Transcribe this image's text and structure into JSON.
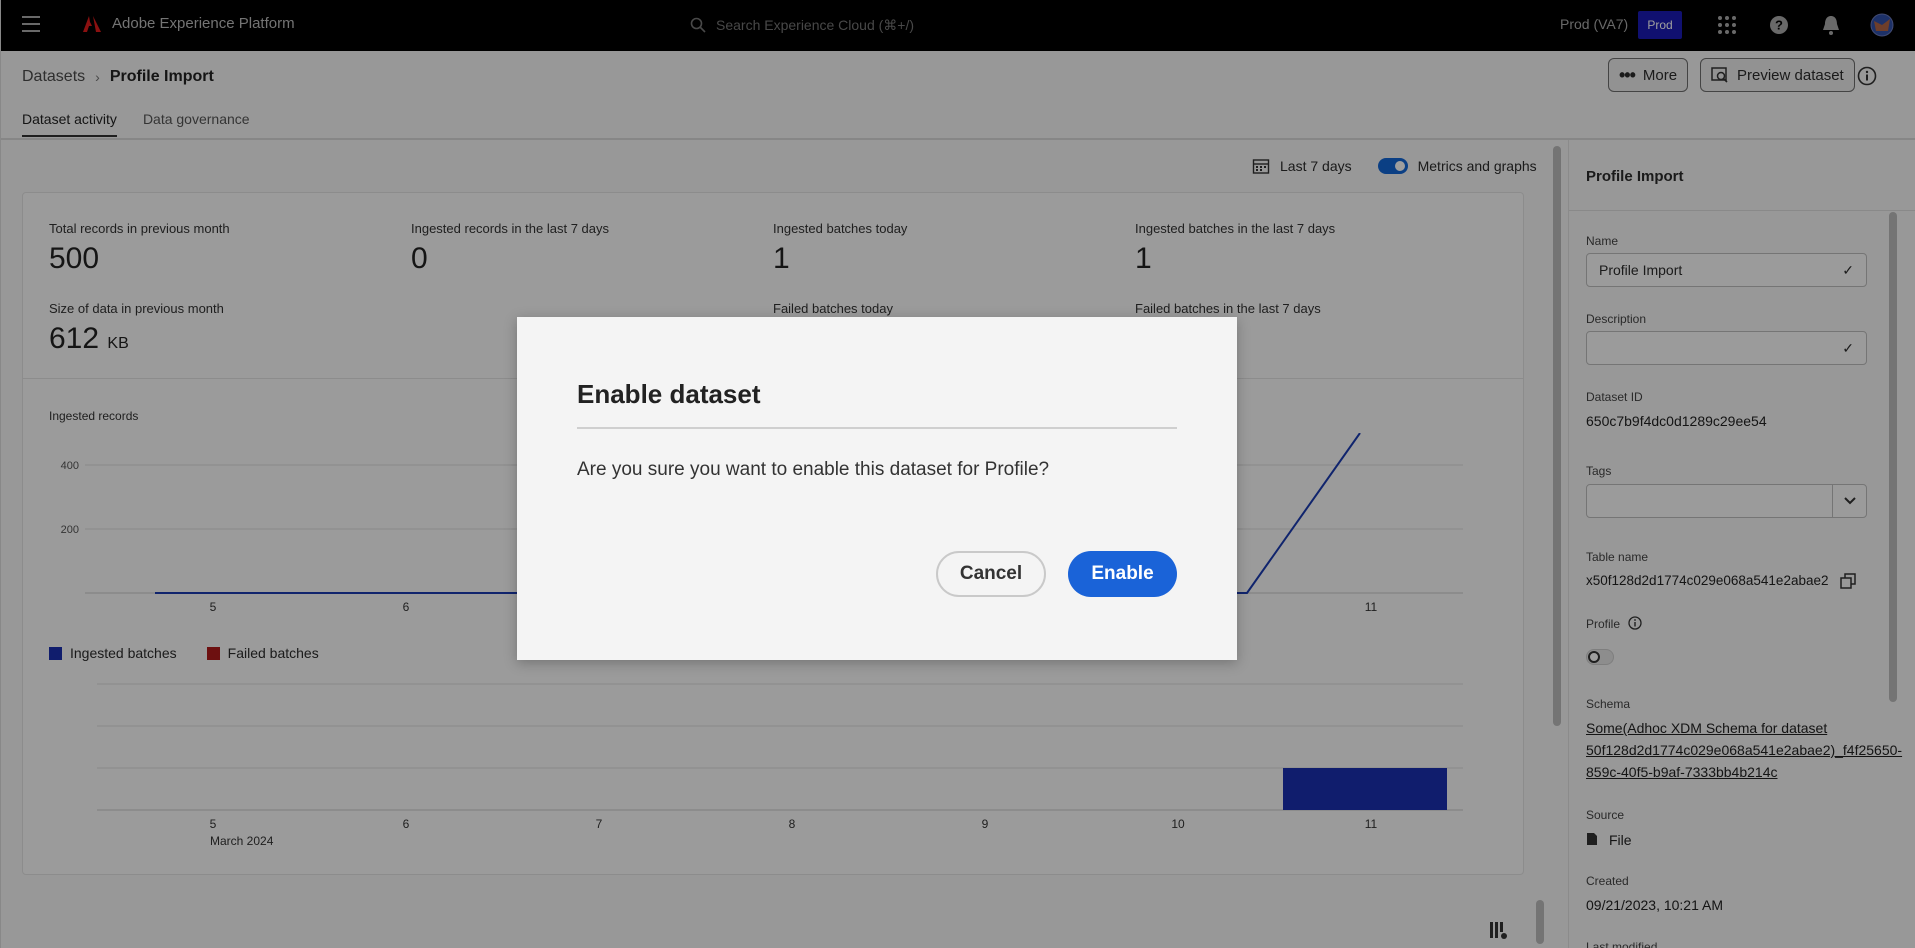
{
  "topbar": {
    "app_name": "Adobe Experience Platform",
    "search_placeholder": "Search Experience Cloud (⌘+/)",
    "org": "Prod (VA7)",
    "sandbox": "Prod",
    "brand_color": "#1b1bb5"
  },
  "breadcrumb": {
    "parent": "Datasets",
    "current": "Profile Import"
  },
  "header_buttons": {
    "more": "More",
    "preview": "Preview dataset"
  },
  "tabs": [
    {
      "label": "Dataset activity"
    },
    {
      "label": "Data governance"
    }
  ],
  "filter": {
    "range": "Last 7 days",
    "toggle_label": "Metrics and graphs"
  },
  "metrics": [
    {
      "label": "Total records in previous month",
      "value": "500"
    },
    {
      "label": "Ingested records in the last 7 days",
      "value": "0"
    },
    {
      "label": "Ingested batches today",
      "value": "1"
    },
    {
      "label": "Ingested batches in the last 7 days",
      "value": "1"
    },
    {
      "label": "Size of data in previous month",
      "value": "612",
      "unit": "KB"
    },
    {
      "label": "Failed batches today",
      "value": ""
    },
    {
      "label": "Failed batches in the last 7 days",
      "value": ""
    }
  ],
  "chart_data": [
    {
      "type": "line",
      "title": "Ingested records",
      "x": [
        "5",
        "6",
        "7",
        "8",
        "9",
        "10",
        "11"
      ],
      "x_sublabel": "March 2024",
      "y_ticks": [
        "400",
        "200"
      ],
      "ylim": [
        0,
        500
      ],
      "series": [
        {
          "values": [
            0,
            0,
            0,
            0,
            0,
            0,
            500
          ],
          "color": "#1a3bb0"
        }
      ]
    },
    {
      "type": "bar",
      "x": [
        "5",
        "6",
        "7",
        "8",
        "9",
        "10",
        "11"
      ],
      "x_sublabel": "March 2024",
      "ylim": [
        0,
        4
      ],
      "series": [
        {
          "name": "Ingested batches",
          "values": [
            0,
            0,
            0,
            0,
            0,
            0,
            1
          ],
          "color": "#1a2fb0"
        },
        {
          "name": "Failed batches",
          "values": [
            0,
            0,
            0,
            0,
            0,
            0,
            0
          ],
          "color": "#b01a1a"
        }
      ]
    }
  ],
  "panel": {
    "title": "Profile Import",
    "name_label": "Name",
    "name_value": "Profile Import",
    "description_label": "Description",
    "description_value": "",
    "dataset_id_label": "Dataset ID",
    "dataset_id": "650c7b9f4dc0d1289c29ee54",
    "tags_label": "Tags",
    "table_name_label": "Table name",
    "table_name": "x50f128d2d1774c029e068a541e2abae2",
    "profile_label": "Profile",
    "schema_label": "Schema",
    "schema_link": "Some(Adhoc XDM Schema for dataset 50f128d2d1774c029e068a541e2abae2)_f4f25650-859c-40f5-b9af-7333bb4b214c",
    "source_label": "Source",
    "source_value": "File",
    "created_label": "Created",
    "created_value": "09/21/2023, 10:21 AM",
    "last_modified_label": "Last modified"
  },
  "modal": {
    "title": "Enable dataset",
    "body": "Are you sure you want to enable this dataset for Profile?",
    "cancel": "Cancel",
    "confirm": "Enable",
    "accent": "#1a63d8"
  }
}
